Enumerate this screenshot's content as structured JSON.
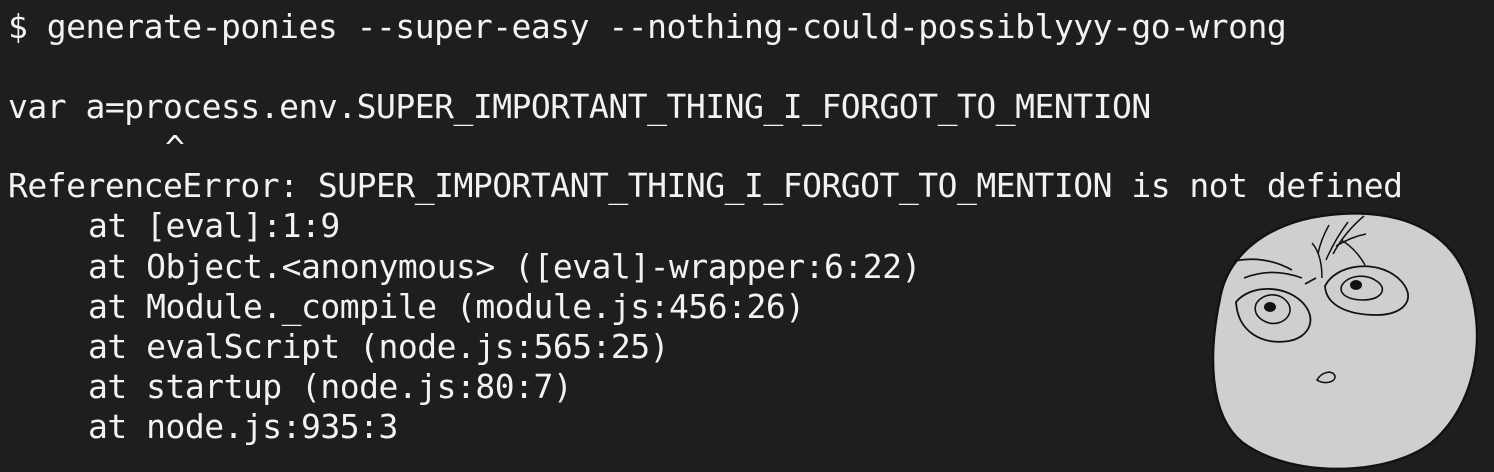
{
  "terminal": {
    "command": "$ generate-ponies --super-easy --nothing-could-possiblyyy-go-wrong",
    "code_line": "var a=process.env.SUPER_IMPORTANT_THING_I_FORGOT_TO_MENTION",
    "caret": "^",
    "error": "ReferenceError: SUPER_IMPORTANT_THING_I_FORGOT_TO_MENTION is not defined",
    "stack": [
      "at [eval]:1:9",
      "at Object.<anonymous> ([eval]-wrapper:6:22)",
      "at Module._compile (module.js:456:26)",
      "at evalScript (node.js:565:25)",
      "at startup (node.js:80:7)",
      "at node.js:935:3"
    ]
  },
  "colors": {
    "background": "#1e1e1e",
    "text": "#f2f2f2",
    "face_fill": "#cfcfcf",
    "face_stroke": "#111111"
  },
  "icons": {
    "face": "skeptical-meme-face-icon"
  }
}
